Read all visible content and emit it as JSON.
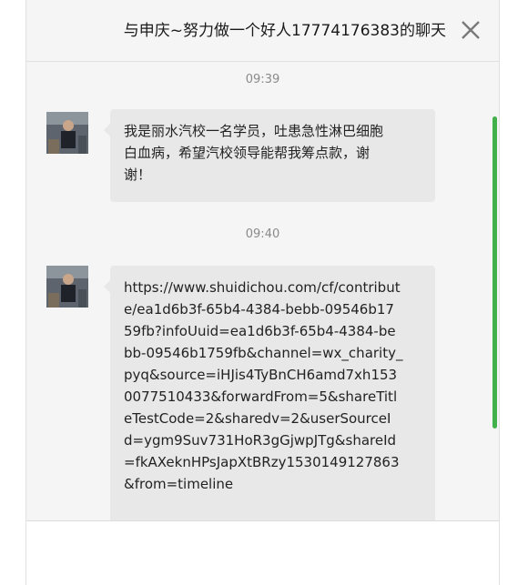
{
  "window": {
    "title": "与申庆~努力做一个好人17774176383的聊天"
  },
  "messages": [
    {
      "time": "09:39",
      "text": "我是丽水汽校一名学员，吐患急性淋巴细胞\n白血病，希望汽校领导能帮我筹点款，谢\n谢！"
    },
    {
      "time": "09:40",
      "text": "https://www.shuidichou.com/cf/contribut\ne/ea1d6b3f-65b4-4384-bebb-09546b17\n59fb?infoUuid=ea1d6b3f-65b4-4384-be\nbb-09546b1759fb&channel=wx_charity_\npyq&source=iHJis4TyBnCH6amd7xh153\n0077510433&forwardFrom=5&shareTitl\neTestCode=2&sharedv=2&userSourceI\nd=ygm9Suv731HoR3gGjwpJTg&shareId\n=fkAXeknHPsJapXtBRzy1530149127863\n&from=timeline"
    }
  ],
  "icons": {
    "close": "close-icon",
    "avatar": "user-avatar"
  },
  "colors": {
    "scrollbar": "#43b14b",
    "bubble": "#e8e8e8",
    "background": "#f5f5f5"
  },
  "scroll_position": 0.45
}
